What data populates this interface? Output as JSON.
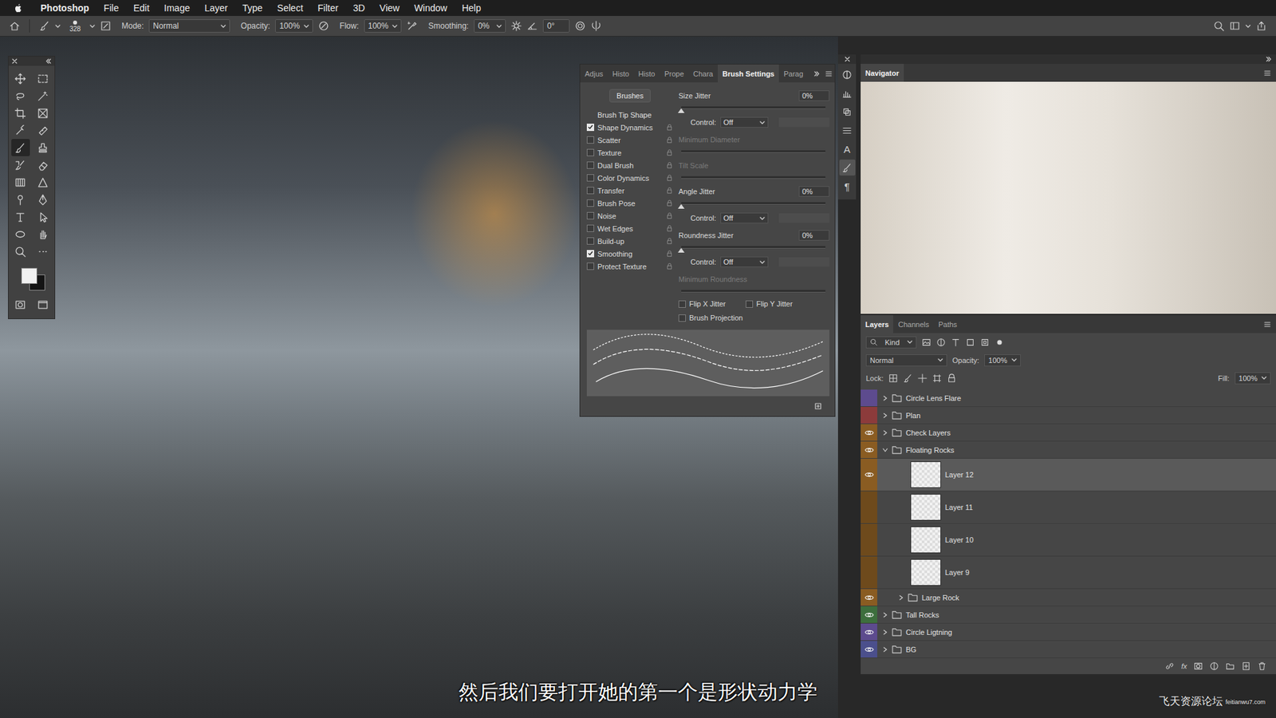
{
  "menu_bar": {
    "app": "Photoshop",
    "items": [
      "File",
      "Edit",
      "Image",
      "Layer",
      "Type",
      "Select",
      "Filter",
      "3D",
      "View",
      "Window",
      "Help"
    ]
  },
  "options_bar": {
    "brush_size": "328",
    "mode_label": "Mode:",
    "mode": "Normal",
    "opacity_label": "Opacity:",
    "opacity": "100%",
    "flow_label": "Flow:",
    "flow": "100%",
    "smoothing_label": "Smoothing:",
    "smoothing": "0%",
    "angle": "0°"
  },
  "tools": [
    {
      "selected": false
    },
    {
      "selected": false
    },
    {
      "selected": false
    },
    {
      "selected": false
    },
    {
      "selected": false
    },
    {
      "selected": false
    },
    {
      "selected": false
    },
    {
      "selected": false
    },
    {
      "selected": true
    },
    {
      "selected": false
    },
    {
      "selected": false
    },
    {
      "selected": false
    },
    {
      "selected": false
    },
    {
      "selected": false
    },
    {
      "selected": false
    },
    {
      "selected": false
    },
    {
      "selected": false
    },
    {
      "selected": false
    },
    {
      "selected": false
    },
    {
      "selected": false
    },
    {
      "selected": false
    },
    {
      "selected": false
    },
    {
      "selected": false
    },
    {
      "selected": false
    }
  ],
  "swatches": {
    "foreground": "#f0f0f0",
    "background": "#141414"
  },
  "side_icons": [
    {
      "kind": "icon",
      "selected": false
    },
    {
      "kind": "icon",
      "selected": false
    },
    {
      "kind": "icon",
      "selected": false
    },
    {
      "kind": "icon",
      "selected": false
    },
    {
      "kind": "glyph",
      "text": "A",
      "selected": false
    },
    {
      "kind": "icon",
      "selected": true
    },
    {
      "kind": "glyph",
      "text": "¶",
      "selected": false
    }
  ],
  "brush_settings": {
    "tabs": [
      {
        "label": "Adjus",
        "selected": false
      },
      {
        "label": "Histo",
        "selected": false
      },
      {
        "label": "Histo",
        "selected": false
      },
      {
        "label": "Prope",
        "selected": false
      },
      {
        "label": "Chara",
        "selected": false
      },
      {
        "label": "Brush Settings",
        "selected": true
      },
      {
        "label": "Parag",
        "selected": false
      }
    ],
    "brushes_button": "Brushes",
    "tip_shape": "Brush Tip Shape",
    "options": [
      {
        "label": "Shape Dynamics",
        "checked": true
      },
      {
        "label": "Scatter",
        "checked": false
      },
      {
        "label": "Texture",
        "checked": false
      },
      {
        "label": "Dual Brush",
        "checked": false
      },
      {
        "label": "Color Dynamics",
        "checked": false
      },
      {
        "label": "Transfer",
        "checked": false
      },
      {
        "label": "Brush Pose",
        "checked": false
      },
      {
        "label": "Noise",
        "checked": false
      },
      {
        "label": "Wet Edges",
        "checked": false
      },
      {
        "label": "Build-up",
        "checked": false
      },
      {
        "label": "Smoothing",
        "checked": true
      },
      {
        "label": "Protect Texture",
        "checked": false
      }
    ],
    "controls": [
      {
        "kind": "slider",
        "label": "Size Jitter",
        "reading": "0%",
        "level": 0,
        "disabled": false
      },
      {
        "kind": "control",
        "label": "Control:",
        "value": "Off",
        "disabled": false
      },
      {
        "kind": "slider",
        "label": "Minimum Diameter",
        "level": 0,
        "disabled": true
      },
      {
        "kind": "slider",
        "label": "Tilt Scale",
        "level": 0,
        "disabled": true
      },
      {
        "kind": "slider",
        "label": "Angle Jitter",
        "reading": "0%",
        "level": 0,
        "disabled": false
      },
      {
        "kind": "control",
        "label": "Control:",
        "value": "Off",
        "disabled": false
      },
      {
        "kind": "slider",
        "label": "Roundness Jitter",
        "reading": "0%",
        "level": 0,
        "disabled": false
      },
      {
        "kind": "control",
        "label": "Control:",
        "value": "Off",
        "disabled": false
      },
      {
        "kind": "slider",
        "label": "Minimum Roundness",
        "level": 0,
        "disabled": true
      }
    ],
    "flips": [
      {
        "label": "Flip X Jitter",
        "checked": false
      },
      {
        "label": "Flip Y Jitter",
        "checked": false
      }
    ],
    "projection": {
      "label": "Brush Projection",
      "checked": false
    }
  },
  "navigator": {
    "title": "Navigator"
  },
  "layers_panel": {
    "tabs": [
      {
        "label": "Layers",
        "selected": true
      },
      {
        "label": "Channels",
        "selected": false
      },
      {
        "label": "Paths",
        "selected": false
      }
    ],
    "filter": "Kind",
    "blend_mode": "Normal",
    "opacity_label": "Opacity:",
    "opacity": "100%",
    "lock_label": "Lock:",
    "fill_label": "Fill:",
    "fill": "100%",
    "footer_fx": "fx",
    "items": [
      {
        "name": "Circle Lens Flare",
        "kind": "group",
        "visible": false,
        "expanded": false,
        "selected": false,
        "depth": 0,
        "color": "#5d4b8e"
      },
      {
        "name": "Plan",
        "kind": "group",
        "visible": false,
        "expanded": false,
        "selected": false,
        "depth": 0,
        "color": "#8c3b3b"
      },
      {
        "name": "Check Layers",
        "kind": "group",
        "visible": true,
        "expanded": false,
        "selected": false,
        "depth": 0,
        "color": "#8a5c22"
      },
      {
        "name": "Floating Rocks",
        "kind": "group",
        "visible": true,
        "expanded": true,
        "selected": false,
        "depth": 0,
        "color": "#8a5c22"
      },
      {
        "name": "Layer 12",
        "kind": "layer",
        "visible": true,
        "expanded": false,
        "selected": true,
        "depth": 1,
        "color": "#8a5c22"
      },
      {
        "name": "Layer 11",
        "kind": "layer",
        "visible": false,
        "expanded": false,
        "selected": false,
        "depth": 1,
        "color": "#6e4a1c"
      },
      {
        "name": "Layer 10",
        "kind": "layer",
        "visible": false,
        "expanded": false,
        "selected": false,
        "depth": 1,
        "color": "#6e4a1c"
      },
      {
        "name": "Layer 9",
        "kind": "layer",
        "visible": false,
        "expanded": false,
        "selected": false,
        "depth": 1,
        "color": "#6e4a1c"
      },
      {
        "name": "Large Rock",
        "kind": "group",
        "visible": true,
        "expanded": false,
        "selected": false,
        "depth": 1,
        "color": "#8a5c22"
      },
      {
        "name": "Tall Rocks",
        "kind": "group",
        "visible": true,
        "expanded": false,
        "selected": false,
        "depth": 0,
        "color": "#3d6e3d"
      },
      {
        "name": "Circle Ligtning",
        "kind": "group",
        "visible": true,
        "expanded": false,
        "selected": false,
        "depth": 0,
        "color": "#5d4b8e"
      },
      {
        "name": "BG",
        "kind": "group",
        "visible": true,
        "expanded": false,
        "selected": false,
        "depth": 0,
        "color": "#4b4f8c"
      }
    ]
  },
  "subtitle": "然后我们要打开她的第一个是形状动力学",
  "watermark": {
    "text": "飞天资源论坛",
    "url": "feitianwu7.com"
  }
}
